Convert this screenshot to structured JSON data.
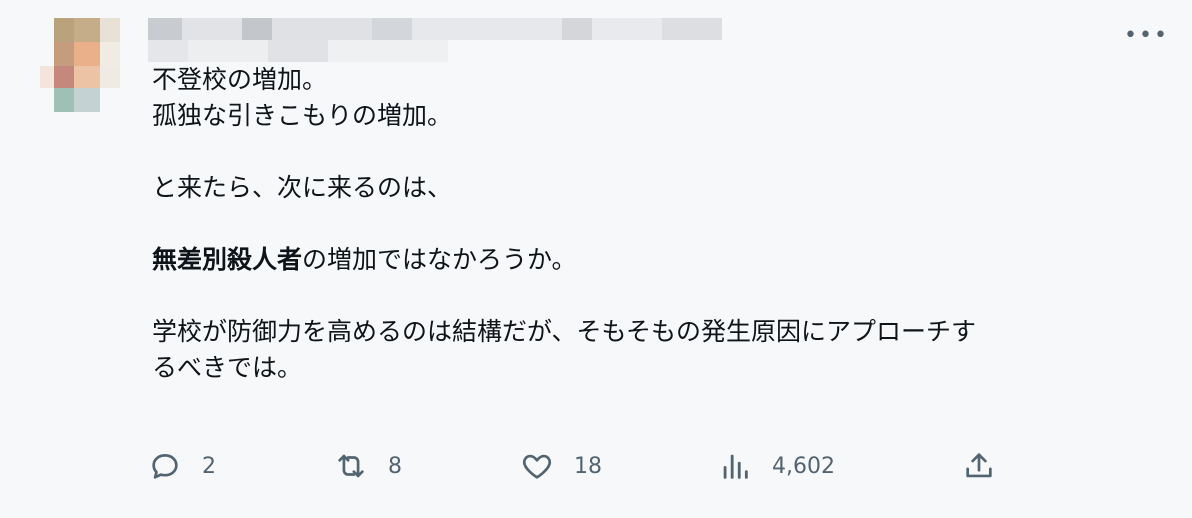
{
  "tweet": {
    "more_label": "•••",
    "lines": [
      "不登校の増加。",
      "孤独な引きこもりの増加。",
      "と来たら、次に来るのは、",
      "",
      "の増加ではなかろうか。",
      "学校が防御力を高めるのは結構だが、そもそもの発生原因にアプローチす",
      "るべきでは。"
    ],
    "bold_part": "無差別殺人者",
    "actions": {
      "reply": {
        "icon": "reply-icon",
        "count": "2"
      },
      "retweet": {
        "icon": "retweet-icon",
        "count": "8"
      },
      "like": {
        "icon": "heart-icon",
        "count": "18"
      },
      "views": {
        "icon": "views-icon",
        "count": "4,602"
      },
      "share": {
        "icon": "share-icon"
      }
    }
  }
}
